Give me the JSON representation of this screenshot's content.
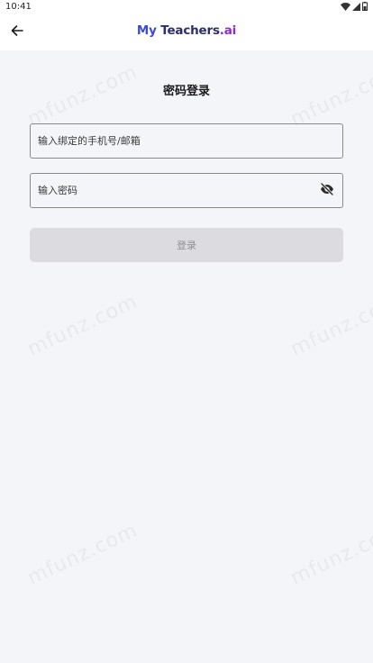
{
  "status_bar": {
    "time": "10:41"
  },
  "app_bar": {
    "brand_part1": "My ",
    "brand_part2": "Teachers",
    "brand_part3": ".ai",
    "colors": {
      "my": "#3b4bd8",
      "teachers": "#2a2e6b",
      "ai": "#8a2bd6"
    }
  },
  "login": {
    "title": "密码登录",
    "account_placeholder": "输入绑定的手机号/邮箱",
    "password_placeholder": "输入密码",
    "submit_label": "登录"
  },
  "watermark": {
    "text": "mfunz.com"
  },
  "icons": {
    "back": "arrow-left-icon",
    "password_visibility": "eye-off-icon",
    "wifi": "wifi-icon",
    "signal": "signal-icon",
    "battery": "battery-icon"
  }
}
